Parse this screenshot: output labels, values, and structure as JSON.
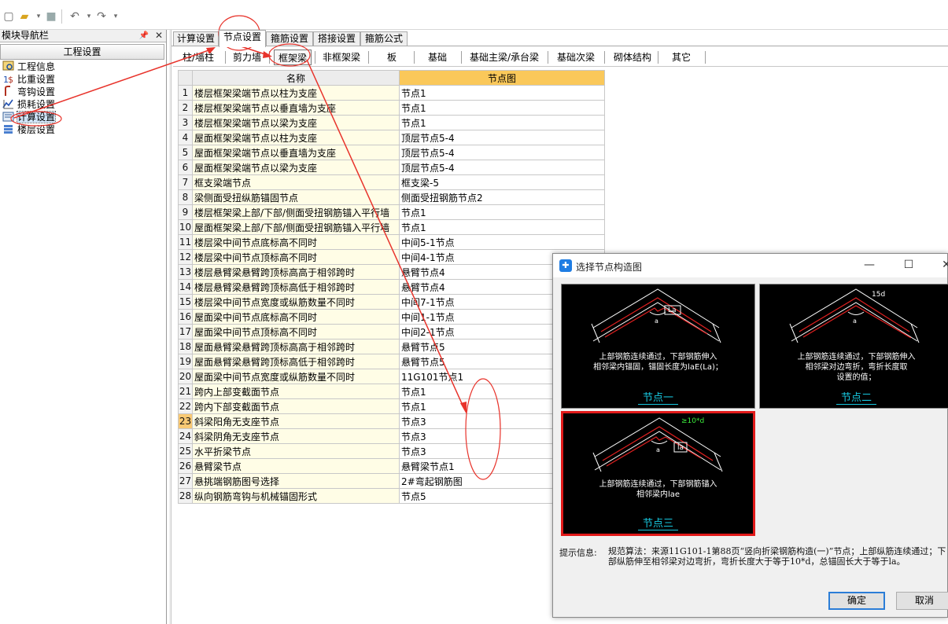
{
  "toolbar": {
    "icons": [
      "new-file-icon",
      "open-folder-icon",
      "save-icon",
      "undo-icon",
      "redo-icon"
    ]
  },
  "nav": {
    "title": "模块导航栏",
    "header": "工程设置",
    "items": [
      {
        "label": "工程信息",
        "icon": "info-icon"
      },
      {
        "label": "比重设置",
        "icon": "weight-icon"
      },
      {
        "label": "弯钩设置",
        "icon": "hook-icon"
      },
      {
        "label": "损耗设置",
        "icon": "loss-icon"
      },
      {
        "label": "计算设置",
        "icon": "calc-icon"
      },
      {
        "label": "楼层设置",
        "icon": "floor-icon"
      }
    ]
  },
  "tabs": [
    "计算设置",
    "节点设置",
    "箍筋设置",
    "搭接设置",
    "箍筋公式"
  ],
  "subtabs": [
    "柱/墙柱",
    "剪力墙",
    "框架梁",
    "非框架梁",
    "板",
    "基础",
    "基础主梁/承台梁",
    "基础次梁",
    "砌体结构",
    "其它"
  ],
  "table": {
    "col_name": "名称",
    "col_node": "节点图",
    "rows": [
      {
        "n": "1",
        "name": "楼层框架梁端节点以柱为支座",
        "val": "节点1"
      },
      {
        "n": "2",
        "name": "楼层框架梁端节点以垂直墙为支座",
        "val": "节点1"
      },
      {
        "n": "3",
        "name": "楼层框架梁端节点以梁为支座",
        "val": "节点1"
      },
      {
        "n": "4",
        "name": "屋面框架梁端节点以柱为支座",
        "val": "顶层节点5-4"
      },
      {
        "n": "5",
        "name": "屋面框架梁端节点以垂直墙为支座",
        "val": "顶层节点5-4"
      },
      {
        "n": "6",
        "name": "屋面框架梁端节点以梁为支座",
        "val": "顶层节点5-4"
      },
      {
        "n": "7",
        "name": "框支梁端节点",
        "val": "框支梁-5"
      },
      {
        "n": "8",
        "name": "梁侧面受扭纵筋锚固节点",
        "val": "侧面受扭钢筋节点2"
      },
      {
        "n": "9",
        "name": "楼层框架梁上部/下部/侧面受扭钢筋锚入平行墙",
        "val": "节点1"
      },
      {
        "n": "10",
        "name": "屋面框架梁上部/下部/侧面受扭钢筋锚入平行墙",
        "val": "节点1"
      },
      {
        "n": "11",
        "name": "楼层梁中间节点底标高不同时",
        "val": "中间5-1节点"
      },
      {
        "n": "12",
        "name": "楼层梁中间节点顶标高不同时",
        "val": "中间4-1节点"
      },
      {
        "n": "13",
        "name": "楼层悬臂梁悬臂跨顶标高高于相邻跨时",
        "val": "悬臂节点4"
      },
      {
        "n": "14",
        "name": "楼层悬臂梁悬臂跨顶标高低于相邻跨时",
        "val": "悬臂节点4"
      },
      {
        "n": "15",
        "name": "楼层梁中间节点宽度或纵筋数量不同时",
        "val": "中间7-1节点"
      },
      {
        "n": "16",
        "name": "屋面梁中间节点底标高不同时",
        "val": "中间1-1节点"
      },
      {
        "n": "17",
        "name": "屋面梁中间节点顶标高不同时",
        "val": "中间2-1节点"
      },
      {
        "n": "18",
        "name": "屋面悬臂梁悬臂跨顶标高高于相邻跨时",
        "val": "悬臂节点5"
      },
      {
        "n": "19",
        "name": "屋面悬臂梁悬臂跨顶标高低于相邻跨时",
        "val": "悬臂节点5"
      },
      {
        "n": "20",
        "name": "屋面梁中间节点宽度或纵筋数量不同时",
        "val": "11G101节点1"
      },
      {
        "n": "21",
        "name": "跨内上部变截面节点",
        "val": "节点1"
      },
      {
        "n": "22",
        "name": "跨内下部变截面节点",
        "val": "节点1"
      },
      {
        "n": "23",
        "name": "斜梁阳角无支座节点",
        "val": "节点3"
      },
      {
        "n": "24",
        "name": "斜梁阴角无支座节点",
        "val": "节点3"
      },
      {
        "n": "25",
        "name": "水平折梁节点",
        "val": "节点3"
      },
      {
        "n": "26",
        "name": "悬臂梁节点",
        "val": "悬臂梁节点1"
      },
      {
        "n": "27",
        "name": "悬挑端钢筋图号选择",
        "val": "2#弯起钢筋图"
      },
      {
        "n": "28",
        "name": "纵向钢筋弯钩与机械锚固形式",
        "val": "节点5"
      }
    ],
    "highlight_row": "23"
  },
  "dialog": {
    "title": "选择节点构造图",
    "panels": [
      {
        "desc1": "上部钢筋连续通过，下部钢筋伸入",
        "desc2": "相邻梁内锚固，锚固长度为laE(La)；",
        "caption": "节点一",
        "dim": "La"
      },
      {
        "desc1": "上部钢筋连续通过，下部钢筋伸入",
        "desc2": "相邻梁对边弯折，弯折长度取",
        "desc3": "设置的值；",
        "caption": "节点二",
        "dim": "15d"
      },
      {
        "desc1": "上部钢筋连续通过，下部钢筋锚入",
        "desc2": "相邻梁内lae",
        "caption": "节点三",
        "dim": "≥10*d",
        "dim2": "la"
      }
    ],
    "selected_panel": 2,
    "hint_label": "提示信息:",
    "hint_text": "规范算法：来源11G101-1第88页“竖向折梁钢筋构造(一)”节点；上部纵筋连续通过；下部纵筋伸至相邻梁对边弯折，弯折长度大于等于10*d，总锚固长大于等于la。",
    "ok": "确定",
    "cancel": "取消"
  },
  "colors": {
    "annotation": "#e8332b",
    "node_header": "#fac85a",
    "name_cell": "#fffde6",
    "caption": "#17c8e0"
  }
}
